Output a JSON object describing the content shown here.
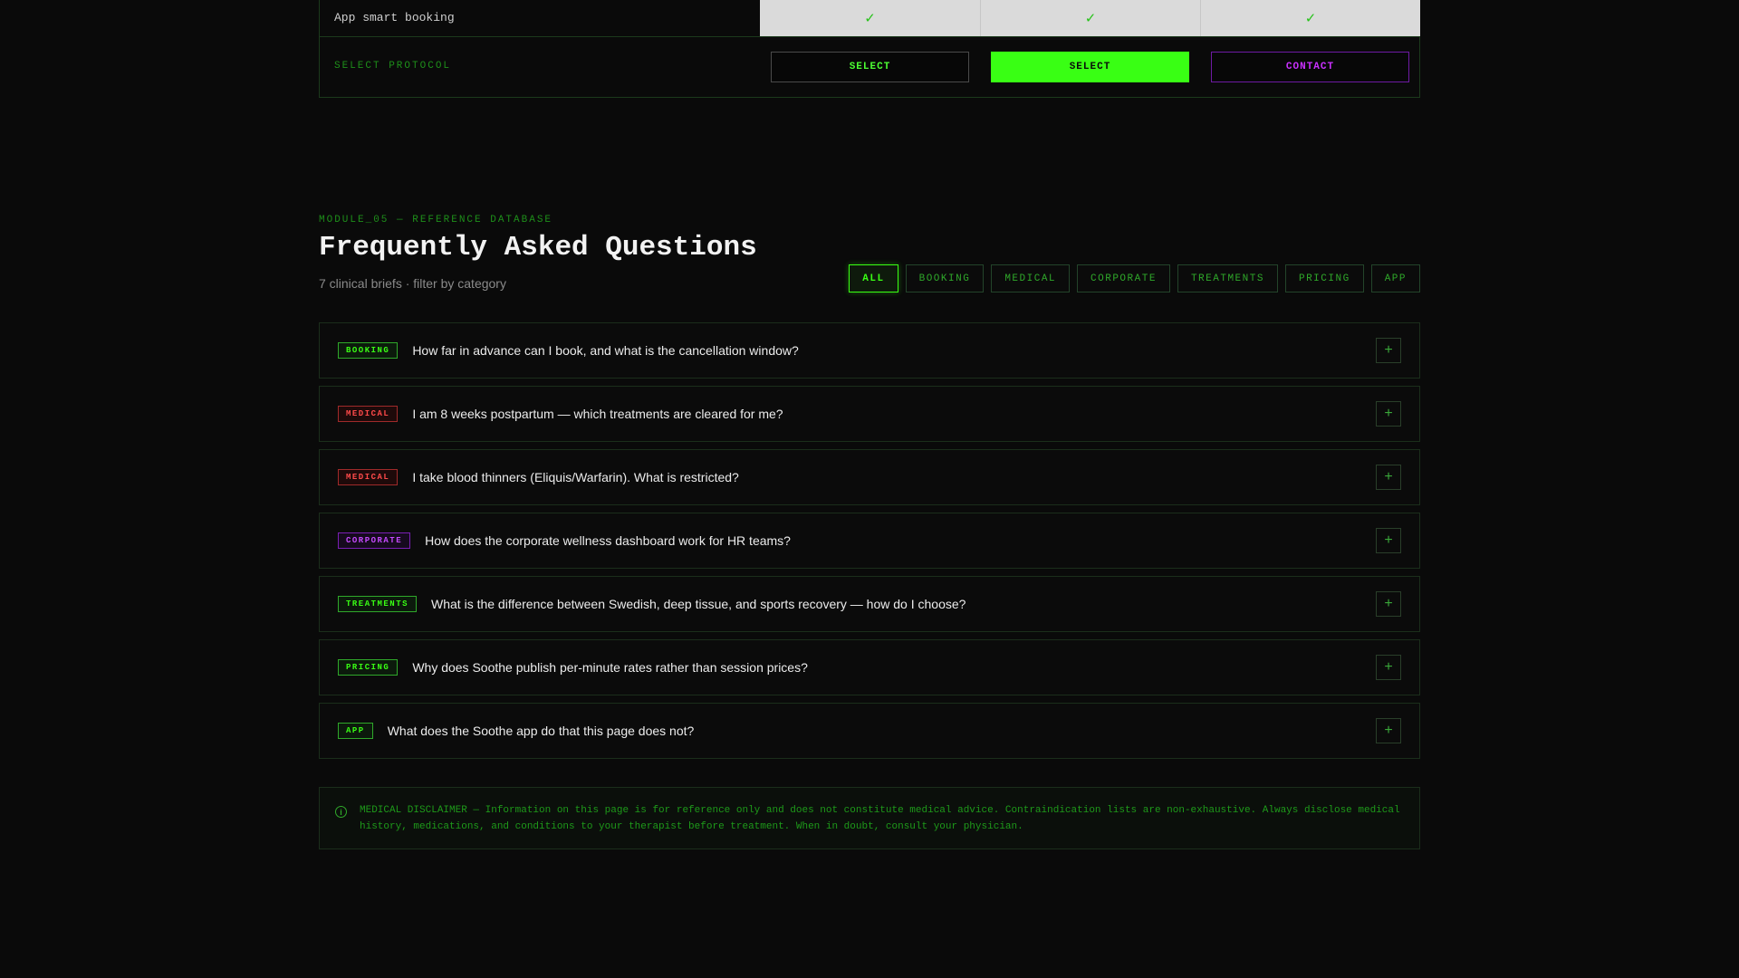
{
  "compare": {
    "row_label": "App smart booking",
    "checks": [
      "✓",
      "✓",
      "✓"
    ],
    "protocol_label": "SELECT PROTOCOL",
    "buttons": [
      "SELECT",
      "SELECT",
      "CONTACT"
    ]
  },
  "faq": {
    "module_label": "MODULE_05 — REFERENCE DATABASE",
    "title": "Frequently Asked Questions",
    "subtitle": "7 clinical briefs · filter by category",
    "filters": [
      {
        "label": "ALL",
        "active": true
      },
      {
        "label": "BOOKING",
        "active": false
      },
      {
        "label": "MEDICAL",
        "active": false
      },
      {
        "label": "CORPORATE",
        "active": false
      },
      {
        "label": "TREATMENTS",
        "active": false
      },
      {
        "label": "PRICING",
        "active": false
      },
      {
        "label": "APP",
        "active": false
      }
    ],
    "items": [
      {
        "tag": "BOOKING",
        "question": "How far in advance can I book, and what is the cancellation window?"
      },
      {
        "tag": "MEDICAL",
        "question": "I am 8 weeks postpartum — which treatments are cleared for me?"
      },
      {
        "tag": "MEDICAL",
        "question": "I take blood thinners (Eliquis/Warfarin). What is restricted?"
      },
      {
        "tag": "CORPORATE",
        "question": "How does the corporate wellness dashboard work for HR teams?"
      },
      {
        "tag": "TREATMENTS",
        "question": "What is the difference between Swedish, deep tissue, and sports recovery — how do I choose?"
      },
      {
        "tag": "PRICING",
        "question": "Why does Soothe publish per-minute rates rather than session prices?"
      },
      {
        "tag": "APP",
        "question": "What does the Soothe app do that this page does not?"
      }
    ],
    "expand_symbol": "+"
  },
  "disclaimer": {
    "icon": "i",
    "text": "MEDICAL DISCLAIMER — Information on this page is for reference only and does not constitute medical advice. Contraindication lists are non-exhaustive. Always disclose medical history, medications, and conditions to your therapist before treatment. When in doubt, consult your physician."
  },
  "colors": {
    "accent": "#39ff14",
    "medical": "#ff4a4a",
    "corporate": "#c64aff",
    "background": "#0a0a0a"
  }
}
